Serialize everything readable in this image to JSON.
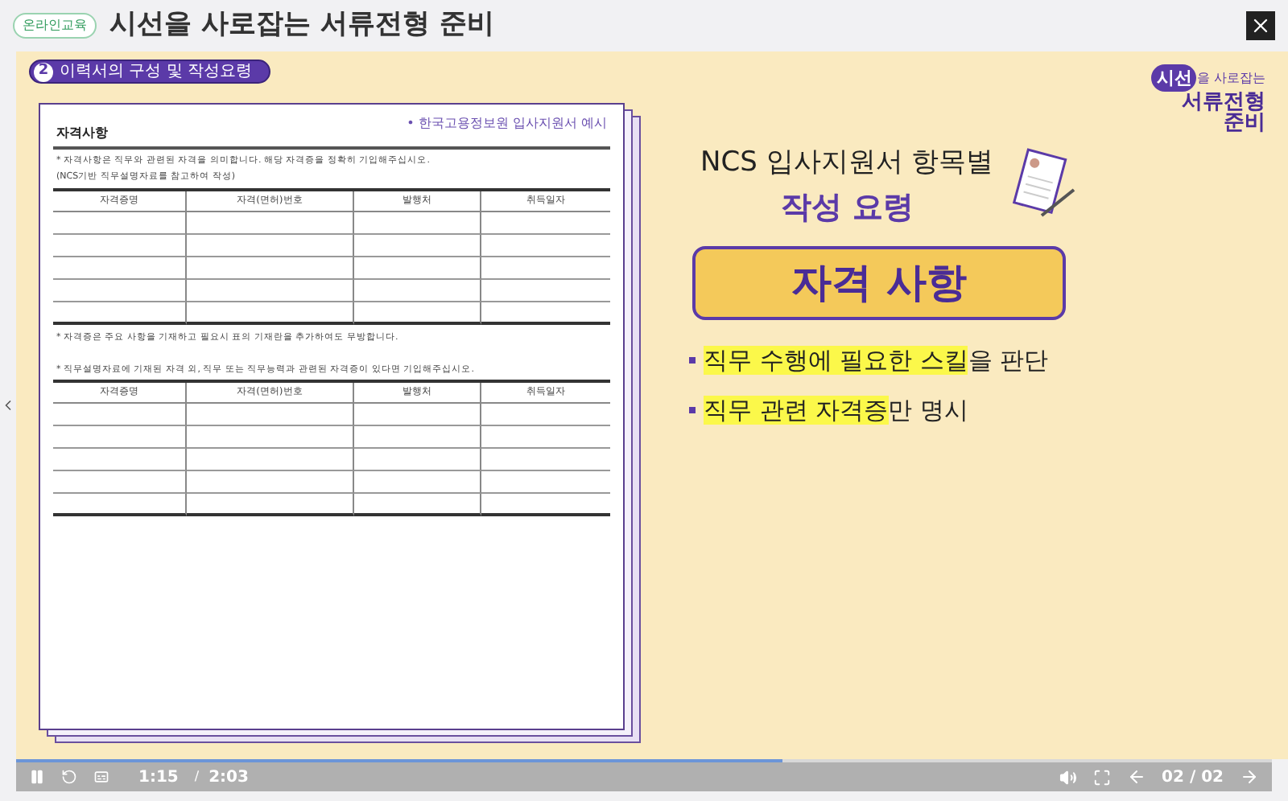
{
  "header": {
    "badge": "온라인교육",
    "title": "시선을 사로잡는 서류전형 준비"
  },
  "slide": {
    "section": {
      "number": "2",
      "label": "이력서의 구성 및 작성요령"
    },
    "logo": {
      "part_1": "시선",
      "part_2": "을 사로잡는",
      "part_3": "서류전형",
      "part_4": "준비"
    },
    "document": {
      "title": "자격사항",
      "source": "• 한국고용정보원 입사지원서 예시",
      "note_1": "* 자격사항은 직무와 관련된 자격을 의미합니다. 해당 자격증을 정확히 기입해주십시오.",
      "note_2": "(NCS기반 직무설명자료를 참고하여 작성)",
      "table_1": {
        "columns": [
          "자격증명",
          "자격(면허)번호",
          "발행처",
          "취득일자"
        ]
      },
      "note_3": "* 자격증은 주요 사항을 기재하고 필요시 표의 기재란을 추가하여도 무방합니다.",
      "note_4": "* 직무설명자료에 기재된 자격 외, 직무 또는 직무능력과 관련된 자격증이 있다면 기입해주십시오.",
      "table_2": {
        "columns": [
          "자격증명",
          "자격(면허)번호",
          "발행처",
          "취득일자"
        ]
      }
    },
    "heading_1": "NCS 입사지원서 항목별",
    "heading_2": "작성 요령",
    "banner": "자격 사항",
    "bullets": [
      [
        {
          "text": "직무 수행에 필요한 스킬",
          "highlight": true
        },
        {
          "text": "을 판단",
          "highlight": false
        }
      ],
      [
        {
          "text": "직무 관련 자격증",
          "highlight": true
        },
        {
          "text": "만 명시",
          "highlight": false
        }
      ]
    ]
  },
  "player": {
    "progress": {
      "level": 0.61
    },
    "current_time": "1:15",
    "separator": "/",
    "total_time": "2:03",
    "page": "02 / 02"
  }
}
